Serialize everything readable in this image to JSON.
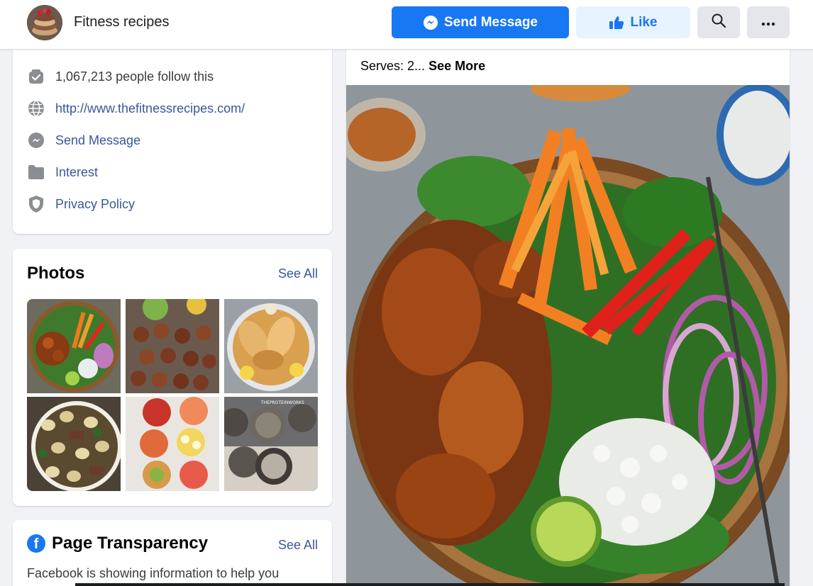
{
  "header": {
    "page_name": "Fitness recipes",
    "send_message_label": "Send Message",
    "like_label": "Like",
    "icons": {
      "messenger": "messenger-icon",
      "like": "thumbs-up-icon",
      "search": "search-icon",
      "more": "more-icon"
    }
  },
  "about": {
    "followers": "1,067,213 people follow this",
    "website": "http://www.thefitnessrecipes.com/",
    "send_message": "Send Message",
    "category": "Interest",
    "privacy": "Privacy Policy"
  },
  "photos": {
    "title": "Photos",
    "see_all": "See All",
    "thumb_watermark": "THEPROTEINWORKS"
  },
  "transparency": {
    "title": "Page Transparency",
    "see_all": "See All",
    "description": "Facebook is showing information to help you"
  },
  "post": {
    "serves_text": "Serves: 2...",
    "see_more": "See More"
  },
  "colors": {
    "brand": "#1877f2",
    "link": "#385898",
    "background": "#f0f2f5"
  }
}
